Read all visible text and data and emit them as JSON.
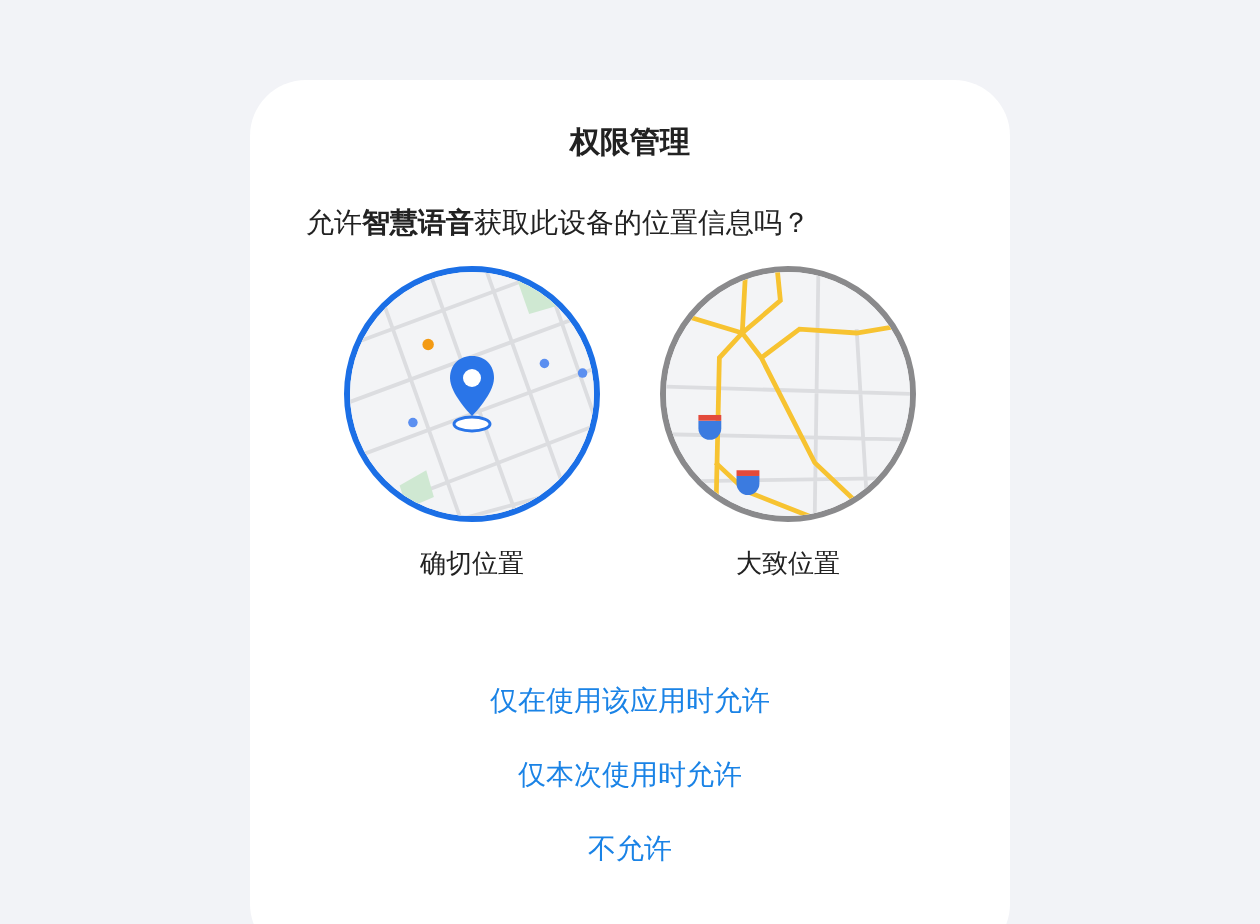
{
  "dialog": {
    "title": "权限管理",
    "message": "允许**智慧语音**获取此设备的位置信息吗？",
    "options": [
      {
        "label": "确切位置",
        "selected": true,
        "kind": "precise"
      },
      {
        "label": "大致位置",
        "selected": false,
        "kind": "approximate"
      }
    ],
    "actions": [
      "仅在使用该应用时允许",
      "仅本次使用时允许",
      "不允许"
    ]
  }
}
